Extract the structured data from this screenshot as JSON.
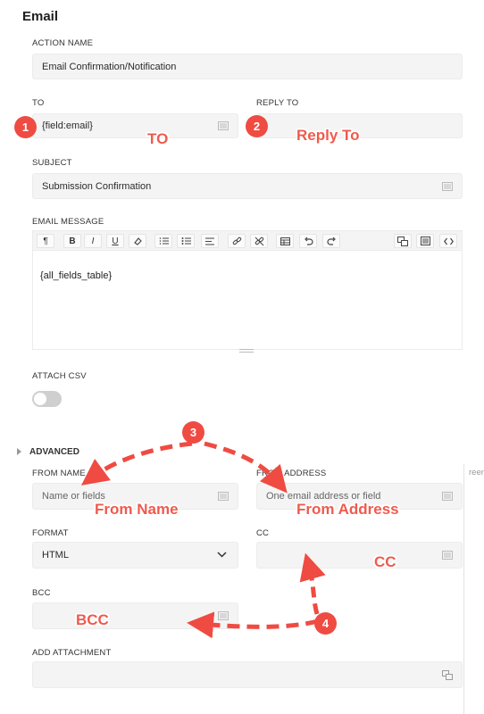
{
  "section": {
    "title": "Email"
  },
  "action_name": {
    "label": "ACTION NAME",
    "value": "Email Confirmation/Notification"
  },
  "to": {
    "label": "TO",
    "value": "{field:email}"
  },
  "reply_to": {
    "label": "REPLY TO",
    "value": ""
  },
  "subject": {
    "label": "SUBJECT",
    "value": "Submission Confirmation"
  },
  "email_message": {
    "label": "EMAIL MESSAGE",
    "content": "{all_fields_table}",
    "toolbar": [
      "paragraph-icon",
      "bold-icon",
      "italic-icon",
      "underline-icon",
      "eraser-icon",
      "ordered-list-icon",
      "bullet-list-icon",
      "align-left-icon",
      "link-icon",
      "unlink-icon",
      "table-icon",
      "undo-icon",
      "redo-icon",
      "merge-tags-icon",
      "fields-icon",
      "code-icon"
    ],
    "toolbar_glyphs": {
      "paragraph": "¶",
      "bold": "B",
      "italic": "I",
      "underline": "U"
    }
  },
  "attach_csv": {
    "label": "ATTACH CSV",
    "enabled": false
  },
  "advanced": {
    "title": "ADVANCED",
    "cutoff_text": "reen"
  },
  "from_name": {
    "label": "FROM NAME",
    "placeholder": "Name or fields"
  },
  "from_address": {
    "label": "FROM ADDRESS",
    "placeholder": "One email address or field"
  },
  "format": {
    "label": "FORMAT",
    "value": "HTML"
  },
  "cc": {
    "label": "CC",
    "value": ""
  },
  "bcc": {
    "label": "BCC",
    "value": ""
  },
  "add_attachment": {
    "label": "ADD ATTACHMENT",
    "value": ""
  },
  "annotations": {
    "badges": [
      "1",
      "2",
      "3",
      "4"
    ],
    "notes": {
      "to": "TO",
      "reply_to": "Reply To",
      "from_name": "From Name",
      "from_address": "From Address",
      "cc": "CC",
      "bcc": "BCC"
    },
    "accent_color": "#ef4b42"
  }
}
